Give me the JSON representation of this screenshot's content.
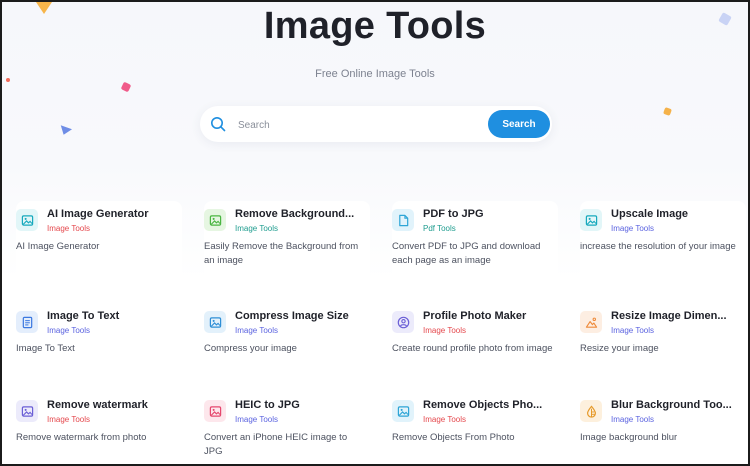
{
  "header": {
    "title": "Image Tools",
    "subtitle": "Free Online Image Tools"
  },
  "search": {
    "placeholder": "Search",
    "button_label": "Search"
  },
  "tools": [
    {
      "title": "AI Image Generator",
      "category": "Image Tools",
      "category_color": "#e5484d",
      "description": "AI Image Generator",
      "icon": "image-icon",
      "icon_bg": "#e2f6f8",
      "icon_color": "#17a9bd"
    },
    {
      "title": "Remove Background...",
      "category": "Image Tools",
      "category_color": "#1f9d8f",
      "description": "Easily Remove the Background from an image",
      "icon": "image-icon",
      "icon_bg": "#e6f6e2",
      "icon_color": "#4bb543"
    },
    {
      "title": "PDF to JPG",
      "category": "Pdf Tools",
      "category_color": "#1f9d8f",
      "description": "Convert PDF to JPG and download each page as an image",
      "icon": "file-icon",
      "icon_bg": "#e1f3fb",
      "icon_color": "#2ea5d6"
    },
    {
      "title": "Upscale Image",
      "category": "Image Tools",
      "category_color": "#5b63e0",
      "description": "increase the resolution of your image",
      "icon": "image-icon",
      "icon_bg": "#e2f6f8",
      "icon_color": "#17a9bd"
    },
    {
      "title": "Image To Text",
      "category": "Image Tools",
      "category_color": "#5b63e0",
      "description": "Image To Text",
      "icon": "text-doc-icon",
      "icon_bg": "#e4eefc",
      "icon_color": "#3b78e0"
    },
    {
      "title": "Compress Image Size",
      "category": "Image Tools",
      "category_color": "#5b63e0",
      "description": "Compress your image",
      "icon": "image-icon",
      "icon_bg": "#e3f1fb",
      "icon_color": "#2f8fd6"
    },
    {
      "title": "Profile Photo Maker",
      "category": "Image Tools",
      "category_color": "#e5484d",
      "description": "Create round profile photo from image",
      "icon": "user-circle-icon",
      "icon_bg": "#ecebfb",
      "icon_color": "#6b5fd6"
    },
    {
      "title": "Resize Image Dimen...",
      "category": "Image Tools",
      "category_color": "#5b63e0",
      "description": "Resize your image",
      "icon": "landscape-icon",
      "icon_bg": "#fdeee2",
      "icon_color": "#ee8a3a"
    },
    {
      "title": "Remove watermark",
      "category": "Image Tools",
      "category_color": "#e5484d",
      "description": "Remove watermark from photo",
      "icon": "image-icon",
      "icon_bg": "#ecebfb",
      "icon_color": "#6b5fd6"
    },
    {
      "title": "HEIC to JPG",
      "category": "Image Tools",
      "category_color": "#5b63e0",
      "description": "Convert an iPhone HEIC image to JPG",
      "icon": "image-icon",
      "icon_bg": "#fde7ec",
      "icon_color": "#e5486e"
    },
    {
      "title": "Remove Objects Pho...",
      "category": "Image Tools",
      "category_color": "#e5484d",
      "description": "Remove Objects From Photo",
      "icon": "image-icon",
      "icon_bg": "#e1f3fb",
      "icon_color": "#2ea5d6"
    },
    {
      "title": "Blur Background Too...",
      "category": "Image Tools",
      "category_color": "#5b63e0",
      "description": "Image background blur",
      "icon": "blur-drop-icon",
      "icon_bg": "#fdf0dd",
      "icon_color": "#e69a2a"
    }
  ]
}
